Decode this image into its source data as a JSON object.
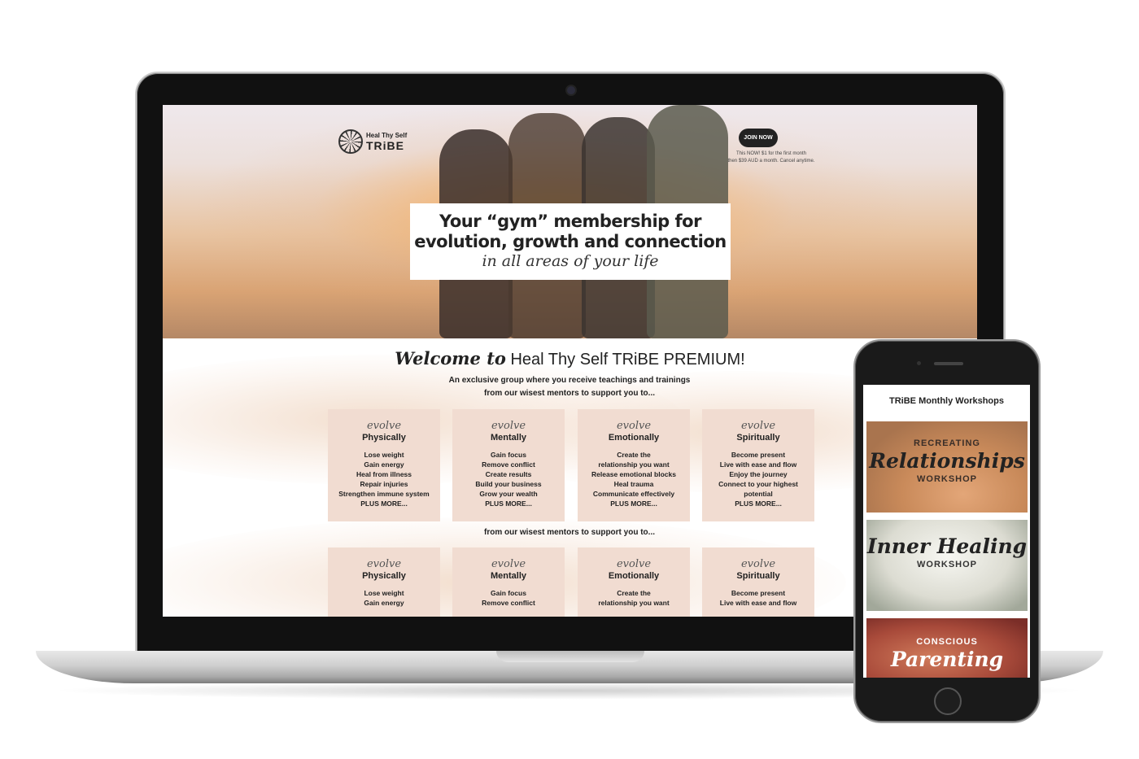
{
  "site": {
    "logo": {
      "line1": "Heal Thy Self",
      "line2": "TRiBE"
    },
    "join_button": "JOIN NOW",
    "join_note_line1": "This NOW! $1 for the first month",
    "join_note_line2": "then $39 AUD a month. Cancel anytime.",
    "hero": {
      "line1": "Your “gym” membership for",
      "line2": "evolution, growth and connection",
      "script": "in all areas of your life"
    },
    "welcome": {
      "script": "Welcome to",
      "title": " Heal Thy Self TRiBE PREMIUM!",
      "sub_line1": "An exclusive group where you receive teachings and trainings",
      "sub_line2": "from our wisest mentors to support you to..."
    },
    "cards": [
      {
        "evolve": "evolve",
        "area": "Physically",
        "items": [
          "Lose weight",
          "Gain energy",
          "Heal from illness",
          "Repair injuries",
          "Strengthen immune system",
          "PLUS MORE..."
        ]
      },
      {
        "evolve": "evolve",
        "area": "Mentally",
        "items": [
          "Gain focus",
          "Remove conflict",
          "Create results",
          "Build your business",
          "Grow your wealth",
          "PLUS MORE..."
        ]
      },
      {
        "evolve": "evolve",
        "area": "Emotionally",
        "items": [
          "Create the",
          "relationship you want",
          "Release emotional blocks",
          "Heal trauma",
          "Communicate effectively",
          "PLUS MORE..."
        ]
      },
      {
        "evolve": "evolve",
        "area": "Spiritually",
        "items": [
          "Become present",
          "Live with ease and flow",
          "Enjoy the journey",
          "Connect to your highest",
          "potential",
          "PLUS MORE..."
        ]
      }
    ],
    "cards_repeat": [
      {
        "evolve": "evolve",
        "area": "Physically",
        "items": [
          "Lose weight",
          "Gain energy"
        ]
      },
      {
        "evolve": "evolve",
        "area": "Mentally",
        "items": [
          "Gain focus",
          "Remove conflict"
        ]
      },
      {
        "evolve": "evolve",
        "area": "Emotionally",
        "items": [
          "Create the",
          "relationship you want"
        ]
      },
      {
        "evolve": "evolve",
        "area": "Spiritually",
        "items": [
          "Become present",
          "Live with ease and flow"
        ]
      }
    ],
    "repeat_sub": "from our wisest mentors to support you to..."
  },
  "phone": {
    "title": "TRiBE Monthly Workshops",
    "workshops": [
      {
        "caps_top": "RECREATING",
        "script": "Relationships",
        "caps_bottom": "WORKSHOP"
      },
      {
        "caps_top": "",
        "script": "Inner Healing",
        "caps_bottom": "WORKSHOP"
      },
      {
        "caps_top": "CONSCIOUS",
        "script": "Parenting",
        "caps_bottom": ""
      }
    ]
  },
  "colors": {
    "card_bg": "#f1dcd1",
    "dark": "#222222",
    "hero_glow": "#f0a860"
  }
}
